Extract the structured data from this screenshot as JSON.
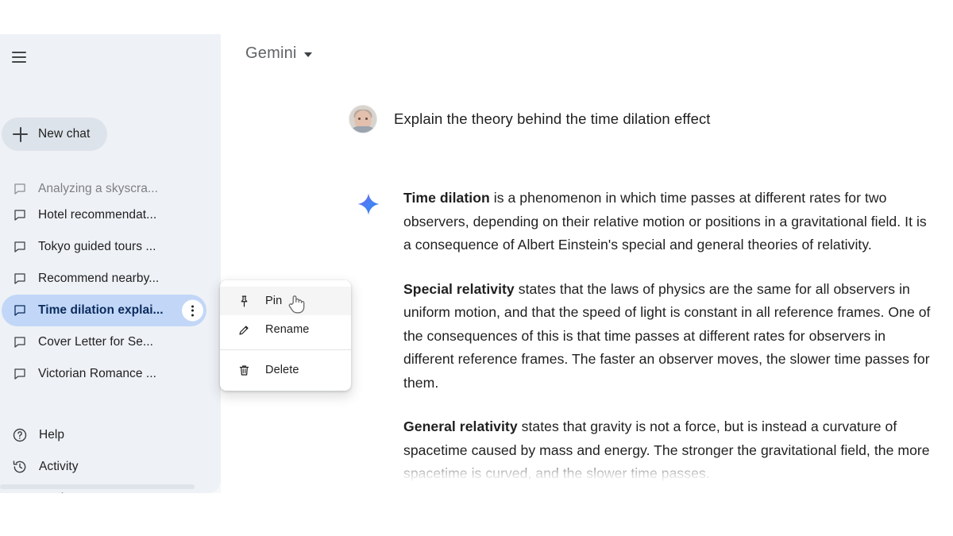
{
  "app": {
    "title": "Gemini",
    "model_caret_icon": "chevron-down-icon",
    "menu_icon": "hamburger-menu-icon"
  },
  "sidebar": {
    "new_chat": {
      "label": "New chat",
      "icon": "plus-icon"
    },
    "chat_items": [
      {
        "label": "Analyzing a skyscra...",
        "icon": "chat-bubble-icon",
        "selected": false,
        "partial": true
      },
      {
        "label": "Hotel recommendat...",
        "icon": "chat-bubble-icon",
        "selected": false,
        "partial": false
      },
      {
        "label": "Tokyo guided tours ...",
        "icon": "chat-bubble-icon",
        "selected": false,
        "partial": false
      },
      {
        "label": "Recommend nearby...",
        "icon": "chat-bubble-icon",
        "selected": false,
        "partial": false
      },
      {
        "label": "Time dilation explai...",
        "icon": "chat-bubble-icon",
        "selected": true,
        "partial": false
      },
      {
        "label": "Cover Letter for Se...",
        "icon": "chat-bubble-icon",
        "selected": false,
        "partial": false
      },
      {
        "label": "Victorian Romance ...",
        "icon": "chat-bubble-icon",
        "selected": false,
        "partial": false
      }
    ],
    "more_button": {
      "icon": "more-vert-icon"
    },
    "nav_items": [
      {
        "label": "Help",
        "icon": "help-circle-icon"
      },
      {
        "label": "Activity",
        "icon": "history-clock-icon"
      },
      {
        "label": "Settings",
        "icon": "gear-icon"
      }
    ]
  },
  "context_menu": {
    "items": [
      {
        "label": "Pin",
        "icon": "pin-icon",
        "hovered": true
      },
      {
        "label": "Rename",
        "icon": "pencil-icon",
        "hovered": false
      },
      {
        "label": "Delete",
        "icon": "trash-icon",
        "hovered": false
      }
    ]
  },
  "conversation": {
    "user": {
      "avatar": "user-avatar-photo",
      "prompt": "Explain the theory behind the time dilation effect"
    },
    "model": {
      "icon": "gemini-sparkle-icon",
      "paragraphs": [
        {
          "lead": "Time dilation",
          "body": " is a phenomenon in which time passes at different rates for two observers, depending on their relative motion or positions in a gravitational field. It is a consequence of Albert Einstein's special and general theories of relativity."
        },
        {
          "lead": "Special relativity",
          "body": " states that the laws of physics are the same for all observers in uniform motion, and that the speed of light is constant in all reference frames. One of the consequences of this is that time passes at different rates for observers in different reference frames. The faster an observer moves, the slower time passes for them."
        },
        {
          "lead": "General relativity",
          "body": " states that gravity is not a force, but is instead a curvature of spacetime caused by mass and energy. The stronger the gravitational field, the more spacetime is curved, and the slower time passes."
        }
      ]
    }
  },
  "colors": {
    "sidebar_bg": "#eef1f6",
    "selected_chat_bg": "#c2d7f7",
    "selected_chat_text": "#0b2b5e",
    "new_chat_bg": "#dde3ea",
    "text_primary": "#1f1f1f",
    "text_secondary": "#5f6368",
    "sparkle_blue": "#4285f4",
    "sparkle_purple": "#7b5cf0",
    "menu_bg": "#ffffff"
  },
  "cursor": {
    "type": "pointer-hand-cursor"
  }
}
